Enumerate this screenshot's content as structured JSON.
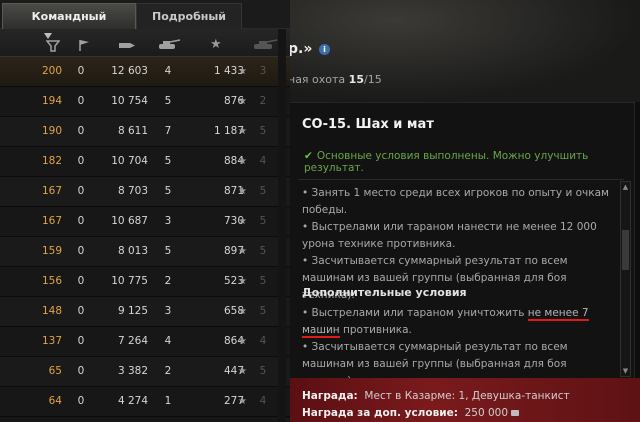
{
  "tabs": {
    "team_result": "Командный результат",
    "detailed_report": "Подробный отчёт"
  },
  "table": {
    "columns": [
      "xp-icon",
      "frag-flag-icon",
      "damage-shell-icon",
      "kills-tank-icon",
      "star-icon",
      "tank-level-icon"
    ],
    "rows": [
      {
        "xp": "200",
        "fr": "0",
        "dmg": "12 603",
        "kills": "4",
        "pts": "1 433",
        "lvl": "3",
        "selected": true
      },
      {
        "xp": "194",
        "fr": "0",
        "dmg": "10 754",
        "kills": "5",
        "pts": "876",
        "lvl": "2"
      },
      {
        "xp": "190",
        "fr": "0",
        "dmg": "8 611",
        "kills": "7",
        "pts": "1 187",
        "lvl": "5"
      },
      {
        "xp": "182",
        "fr": "0",
        "dmg": "10 704",
        "kills": "5",
        "pts": "884",
        "lvl": "4"
      },
      {
        "xp": "167",
        "fr": "0",
        "dmg": "8 703",
        "kills": "5",
        "pts": "871",
        "lvl": "5"
      },
      {
        "xp": "167",
        "fr": "0",
        "dmg": "10 687",
        "kills": "3",
        "pts": "730",
        "lvl": "5"
      },
      {
        "xp": "159",
        "fr": "0",
        "dmg": "8 013",
        "kills": "5",
        "pts": "897",
        "lvl": "5"
      },
      {
        "xp": "156",
        "fr": "0",
        "dmg": "10 775",
        "kills": "2",
        "pts": "523",
        "lvl": "5"
      },
      {
        "xp": "148",
        "fr": "0",
        "dmg": "9 125",
        "kills": "3",
        "pts": "658",
        "lvl": "5"
      },
      {
        "xp": "137",
        "fr": "0",
        "dmg": "7 264",
        "kills": "4",
        "pts": "864",
        "lvl": "4"
      },
      {
        "xp": "65",
        "fr": "0",
        "dmg": "3 382",
        "kills": "2",
        "pts": "447",
        "lvl": "5"
      },
      {
        "xp": "64",
        "fr": "0",
        "dmg": "4 274",
        "kills": "1",
        "pts": "277",
        "lvl": "4"
      }
    ]
  },
  "banner": {
    "title": "р.»",
    "hunt_label": "ная охота ",
    "hunt_count": "15",
    "hunt_total": "/15"
  },
  "quest": {
    "title": "СО-15. Шах и мат",
    "status": "Основные условия выполнены. Можно улучшить результат.",
    "main_conditions": [
      "• Занять 1 место среди всех игроков по опыту и очкам победы.",
      "• Выстрелами или тараном нанести не менее 12 000 урона технике противника.",
      "• Засчитывается суммарный результат по всем машинам из вашей группы (выбранная для боя техника)."
    ],
    "additional_title": "Дополнительные условия",
    "additional_1_pre": "• Выстрелами или тараном уничтожить ",
    "additional_1_highlight": "не менее 7 машин",
    "additional_1_post": " противника.",
    "additional_2": "• Засчитывается суммарный результат по всем машинам из вашей группы (выбранная для боя техника)."
  },
  "reward": {
    "label": "Награда:",
    "value": "Мест в Казарме: 1, Девушка-танкист",
    "bonus_label": "Награда за доп. условие:",
    "bonus_value": "250 000"
  },
  "colors": {
    "xp": "#e0a447",
    "status_green": "#69a64a",
    "highlight_red": "#e01919",
    "reward_bg": "#7a1a1d"
  }
}
